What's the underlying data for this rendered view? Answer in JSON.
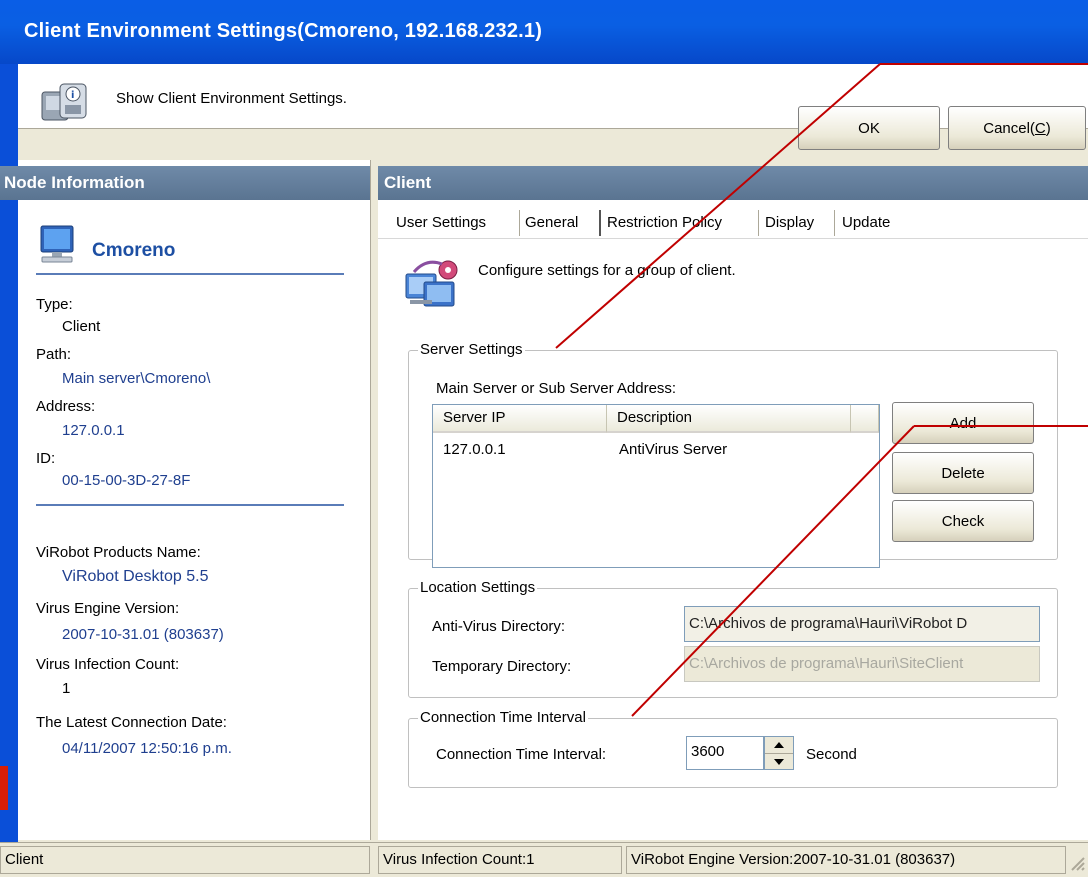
{
  "window": {
    "title": "Client Environment Settings(Cmoreno, 192.168.232.1)"
  },
  "header": {
    "description": "Show Client Environment Settings.",
    "ok_label": "OK",
    "cancel_label": "Cancel(C)"
  },
  "node_info": {
    "heading": "Node Information",
    "node_name": "Cmoreno",
    "type_label": "Type:",
    "type_value": "Client",
    "path_label": "Path:",
    "path_value": "Main server\\Cmoreno\\",
    "address_label": "Address:",
    "address_value": "127.0.0.1",
    "id_label": "ID:",
    "id_value": "00-15-00-3D-27-8F",
    "product_label": "ViRobot Products Name:",
    "product_value": "ViRobot Desktop 5.5",
    "engine_label": "Virus Engine Version:",
    "engine_value": "2007-10-31.01 (803637)",
    "infection_label": "Virus Infection Count:",
    "infection_value": "1",
    "last_conn_label": "The Latest Connection Date:",
    "last_conn_value": "04/11/2007 12:50:16 p.m."
  },
  "client": {
    "heading": "Client",
    "tabs": [
      "User Settings",
      "General",
      "Restriction Policy",
      "Display",
      "Update"
    ],
    "active_tab": "General",
    "description": "Configure settings for a group of client.",
    "server_settings": {
      "title": "Server Settings",
      "list_label": "Main Server or Sub Server Address:",
      "columns": [
        "Server IP",
        "Description"
      ],
      "rows": [
        {
          "ip": "127.0.0.1",
          "description": "AntiVirus Server"
        }
      ],
      "add_label": "Add",
      "delete_label": "Delete",
      "check_label": "Check"
    },
    "location_settings": {
      "title": "Location Settings",
      "antivirus_label": "Anti-Virus Directory:",
      "antivirus_value": "C:\\Archivos de programa\\Hauri\\ViRobot D",
      "temp_label": "Temporary Directory:",
      "temp_value": "C:\\Archivos de programa\\Hauri\\SiteClient"
    },
    "connection": {
      "title": "Connection Time Interval",
      "label": "Connection Time Interval:",
      "value": "3600",
      "unit": "Second"
    }
  },
  "status_bar": {
    "pane1": "Client",
    "pane2": "Virus Infection Count:1",
    "pane3": "ViRobot Engine Version:2007-10-31.01 (803637)"
  },
  "colors": {
    "title_bar": "#0a5ee6",
    "panel_header": "#5a7491",
    "node_text": "#1d4fa3",
    "annotation_line": "#c00000"
  }
}
